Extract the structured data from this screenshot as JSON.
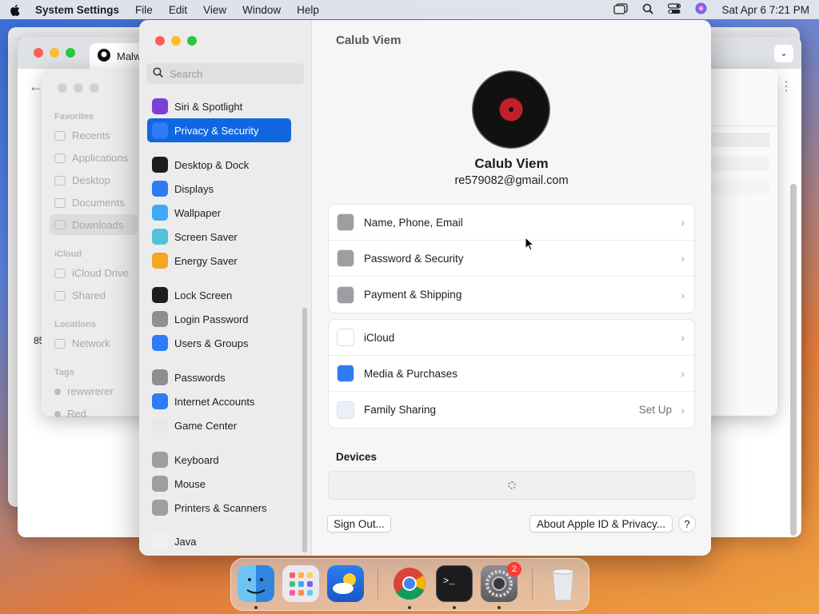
{
  "menubar": {
    "app_name": "System Settings",
    "items": [
      "File",
      "Edit",
      "View",
      "Window",
      "Help"
    ],
    "clock": "Sat Apr 6  7:21 PM"
  },
  "background_browser": {
    "tab_title": "Malw"
  },
  "finder": {
    "favorites_header": "Favorites",
    "favorites": [
      "Recents",
      "Applications",
      "Desktop",
      "Documents",
      "Downloads"
    ],
    "icloud_header": "iCloud",
    "icloud": [
      "iCloud Drive",
      "Shared"
    ],
    "locations_header": "Locations",
    "locations": [
      "Network"
    ],
    "tags_header": "Tags",
    "tags": [
      "rewwrerer",
      "Red"
    ],
    "partial_text": "85"
  },
  "settings": {
    "search_placeholder": "Search",
    "sidebar": [
      {
        "label": "Siri & Spotlight",
        "icon": "siri-icon",
        "color": "#7b3fd6"
      },
      {
        "label": "Privacy & Security",
        "icon": "hand-icon",
        "color": "#2f7bf5",
        "selected": true
      },
      {
        "label": "Desktop & Dock",
        "icon": "dock-icon",
        "color": "#1d1d1f"
      },
      {
        "label": "Displays",
        "icon": "sun-icon",
        "color": "#2f7bf5"
      },
      {
        "label": "Wallpaper",
        "icon": "flower-icon",
        "color": "#3fa9f5"
      },
      {
        "label": "Screen Saver",
        "icon": "screensaver-icon",
        "color": "#4fc3d9"
      },
      {
        "label": "Energy Saver",
        "icon": "bulb-icon",
        "color": "#f5a623"
      },
      {
        "label": "Lock Screen",
        "icon": "lock-icon",
        "color": "#1d1d1f"
      },
      {
        "label": "Login Password",
        "icon": "lock-icon",
        "color": "#8e8e93"
      },
      {
        "label": "Users & Groups",
        "icon": "users-icon",
        "color": "#2f7bf5"
      },
      {
        "label": "Passwords",
        "icon": "key-icon",
        "color": "#8e8e93"
      },
      {
        "label": "Internet Accounts",
        "icon": "at-icon",
        "color": "#2f7bf5"
      },
      {
        "label": "Game Center",
        "icon": "gamecenter-icon",
        "color": "#e8e8e8"
      },
      {
        "label": "Keyboard",
        "icon": "keyboard-icon",
        "color": "#9e9ea2"
      },
      {
        "label": "Mouse",
        "icon": "mouse-icon",
        "color": "#9e9ea2"
      },
      {
        "label": "Printers & Scanners",
        "icon": "printer-icon",
        "color": "#9e9ea2"
      },
      {
        "label": "Java",
        "icon": "java-icon",
        "color": "#f0f0f0"
      }
    ],
    "content": {
      "title": "Calub Viem",
      "name": "Calub Viem",
      "email": "re579082@gmail.com",
      "group1": [
        {
          "label": "Name, Phone, Email",
          "icon": "person-icon",
          "color": "#9e9ea2"
        },
        {
          "label": "Password & Security",
          "icon": "lock-icon",
          "color": "#9e9ea2"
        },
        {
          "label": "Payment & Shipping",
          "icon": "card-icon",
          "color": "#9e9ea2"
        }
      ],
      "group2": [
        {
          "label": "iCloud",
          "icon": "cloud-icon",
          "color": "#ffffff"
        },
        {
          "label": "Media & Purchases",
          "icon": "appstore-icon",
          "color": "#2f7bf5"
        },
        {
          "label": "Family Sharing",
          "icon": "family-icon",
          "color": "#e8f1fb",
          "value": "Set Up"
        }
      ],
      "devices_header": "Devices",
      "sign_out": "Sign Out...",
      "about": "About Apple ID & Privacy...",
      "help": "?"
    }
  },
  "dock": {
    "apps": [
      "Finder",
      "Launchpad",
      "Weather",
      "Google Chrome",
      "Terminal",
      "System Settings",
      "Trash"
    ],
    "badge": "2"
  }
}
